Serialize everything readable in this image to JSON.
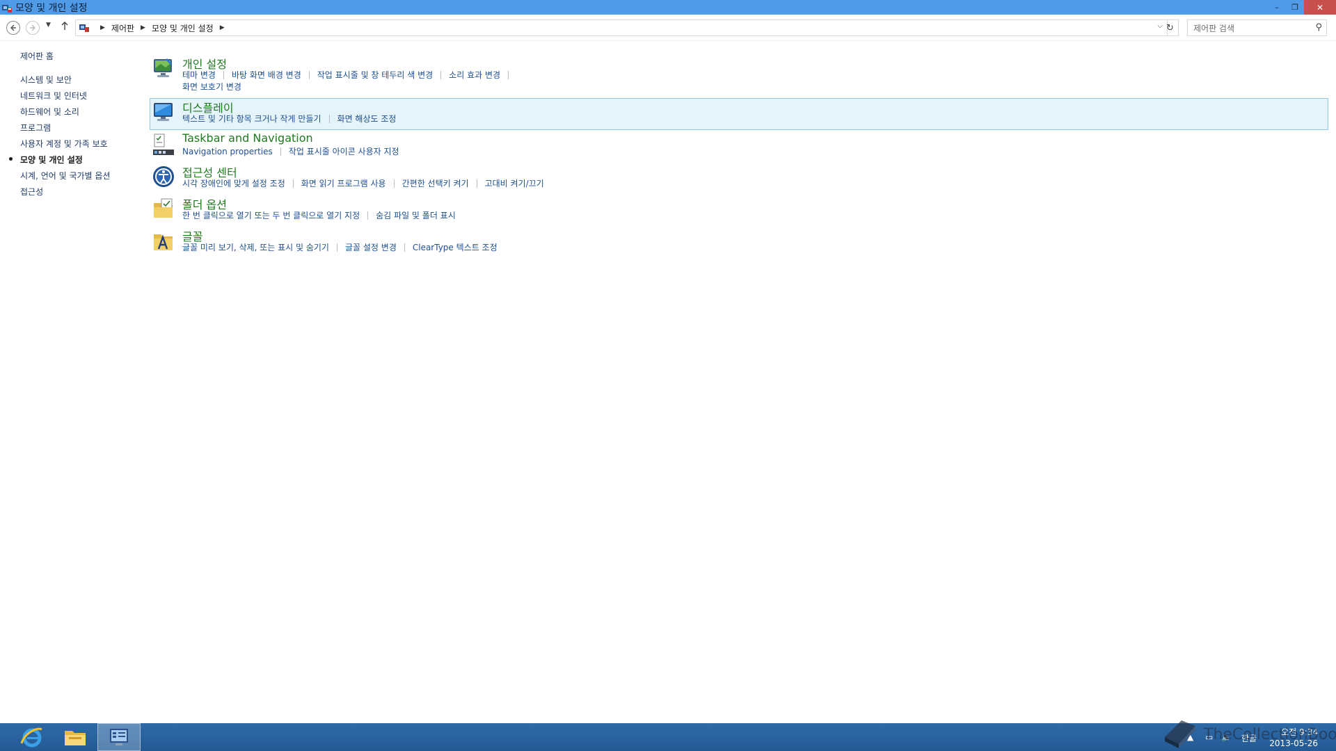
{
  "window": {
    "title": "모양 및 개인 설정",
    "minimize": "–",
    "restore": "❐",
    "close": "✕"
  },
  "address": {
    "breadcrumbs": [
      "제어판",
      "모양 및 개인 설정"
    ],
    "search_placeholder": "제어판 검색"
  },
  "sidebar": {
    "home": "제어판 홈",
    "items": [
      {
        "label": "시스템 및 보안"
      },
      {
        "label": "네트워크 및 인터넷"
      },
      {
        "label": "하드웨어 및 소리"
      },
      {
        "label": "프로그램"
      },
      {
        "label": "사용자 계정 및 가족 보호"
      },
      {
        "label": "모양 및 개인 설정"
      },
      {
        "label": "시계, 언어 및 국가별 옵션"
      },
      {
        "label": "접근성"
      }
    ]
  },
  "sections": [
    {
      "title": "개인 설정",
      "icon": "personalization-icon",
      "links": [
        "테마 변경",
        "바탕 화면 배경 변경",
        "작업 표시줄 및 창 테두리 색 변경",
        "소리 효과 변경"
      ],
      "links2": [
        "화면 보호기 변경"
      ]
    },
    {
      "title": "디스플레이",
      "icon": "display-icon",
      "links": [
        "텍스트 및 기타 항목 크거나 작게 만들기",
        "화면 해상도 조정"
      ]
    },
    {
      "title": "Taskbar and Navigation",
      "icon": "taskbar-icon",
      "links": [
        "Navigation properties",
        "작업 표시줄 아이콘 사용자 지정"
      ]
    },
    {
      "title": "접근성 센터",
      "icon": "ease-of-access-icon",
      "links": [
        "시각 장애인에 맞게 설정 조정",
        "화면 읽기 프로그램 사용",
        "간편한 선택키 켜기",
        "고대비 켜기/끄기"
      ]
    },
    {
      "title": "폴더 옵션",
      "icon": "folder-options-icon",
      "links": [
        "한 번 클릭으로 열기 또는 두 번 클릭으로 열기 지정",
        "숨김 파일 및 폴더 표시"
      ]
    },
    {
      "title": "글꼴",
      "icon": "fonts-icon",
      "links": [
        "글꼴 미리 보기, 삭제, 또는 표시 및 숨기기",
        "글꼴 설정 변경",
        "ClearType 텍스트 조정"
      ]
    }
  ],
  "taskbar": {
    "ime": "한글",
    "time": "오전 9:34",
    "date": "2013-05-26"
  },
  "watermark": "TheCollectionBook",
  "colors": {
    "titlebar": "#4f9be8",
    "section_title": "#1f7a1f",
    "link": "#1d4f91",
    "highlight": "#e5f3fb",
    "taskbar": "#2a63a0"
  }
}
